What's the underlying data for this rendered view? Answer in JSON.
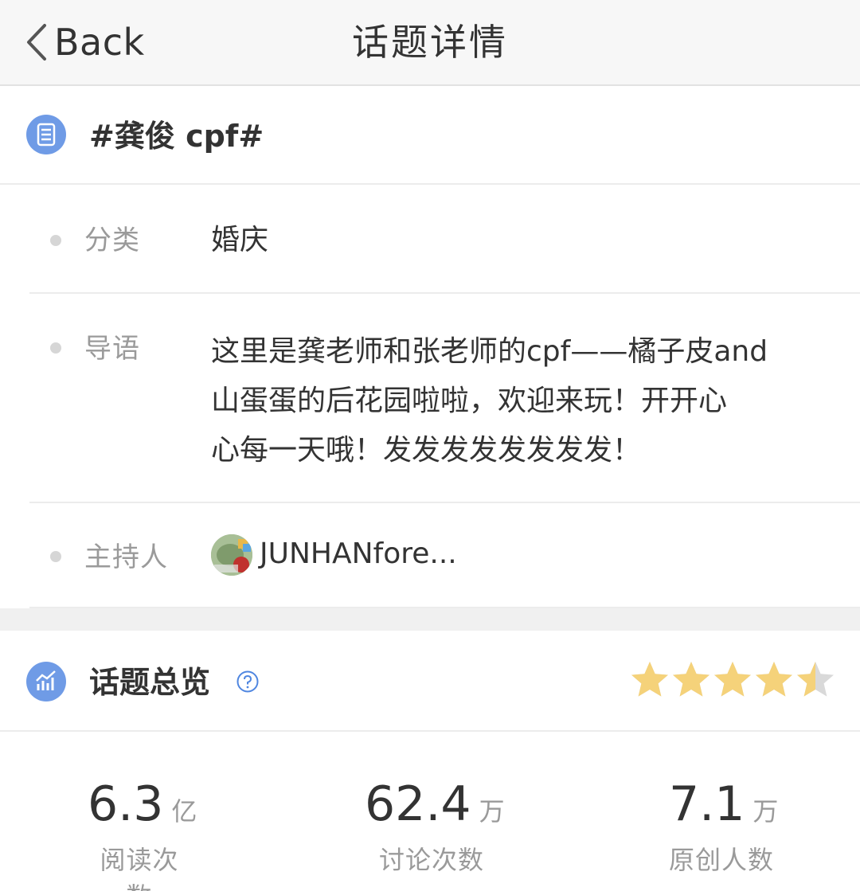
{
  "nav": {
    "back_label": "Back",
    "title": "话题详情"
  },
  "topic": {
    "icon": "document-list-icon",
    "name": "#龚俊 cpf#"
  },
  "info": {
    "category_label": "分类",
    "category_value": "婚庆",
    "intro_label": "导语",
    "intro_lines": [
      "这里是龚老师和张老师的cpf——橘子皮and",
      "山蛋蛋的后花园啦啦，欢迎来玩！开开心",
      "心每一天哦！发发发发发发发发！"
    ],
    "host_label": "主持人",
    "host_name": "JUNHANfore..."
  },
  "overview": {
    "icon": "bar-chart-icon",
    "title": "话题总览",
    "rating": 4.5,
    "stats": [
      {
        "value": "6.3",
        "unit": "亿",
        "label": "阅读次数"
      },
      {
        "value": "62.4",
        "unit": "万",
        "label": "讨论次数"
      },
      {
        "value": "7.1",
        "unit": "万",
        "label": "原创人数"
      }
    ]
  },
  "colors": {
    "accent": "#6f9be6",
    "star": "#f5d27a",
    "star_empty": "#d9d9d9"
  }
}
